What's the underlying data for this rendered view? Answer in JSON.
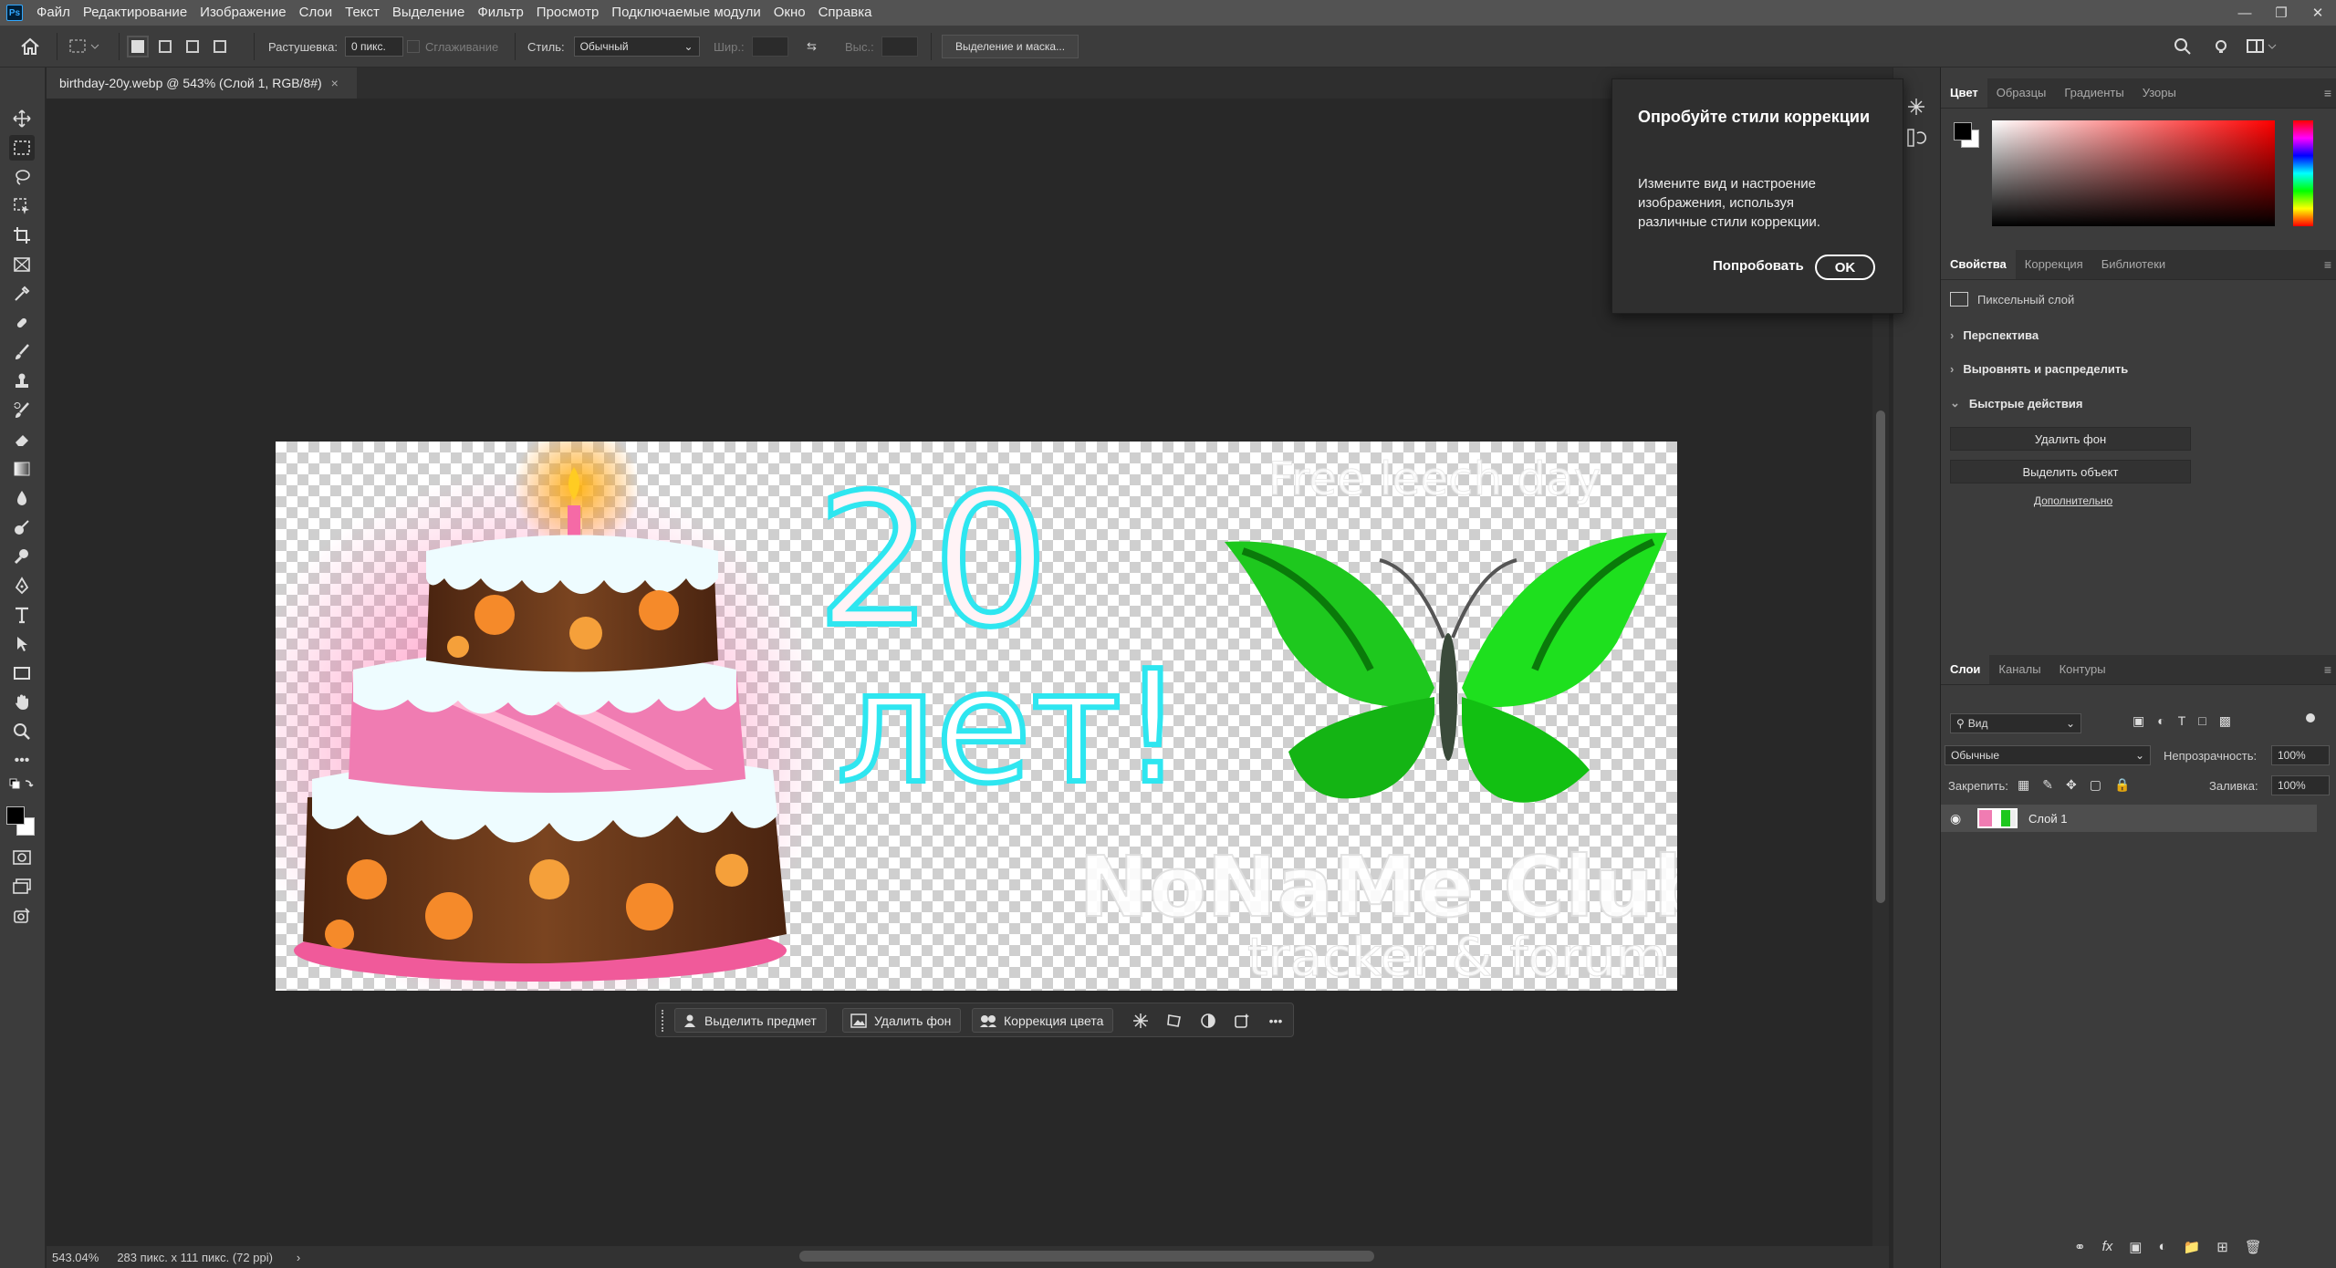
{
  "menubar": {
    "items": [
      "Файл",
      "Редактирование",
      "Изображение",
      "Слои",
      "Текст",
      "Выделение",
      "Фильтр",
      "Просмотр",
      "Подключаемые модули",
      "Окно",
      "Справка"
    ]
  },
  "options": {
    "feather_label": "Растушевка:",
    "feather_value": "0 пикс.",
    "antialias_label": "Сглаживание",
    "style_label": "Стиль:",
    "style_value": "Обычный",
    "width_label": "Шир.:",
    "height_label": "Выс.:",
    "select_mask_button": "Выделение и маска..."
  },
  "document": {
    "tab_title": "birthday-20y.webp @ 543% (Слой 1, RGB/8#)",
    "close_glyph": "×"
  },
  "canvas_art": {
    "number": "20",
    "word": "лет!",
    "top_text": "Free leech day",
    "club": "NoNaMe Club",
    "club_sub": "tracker & forum"
  },
  "context_bar": {
    "select_subject": "Выделить предмет",
    "remove_bg": "Удалить фон",
    "color_correction": "Коррекция цвета",
    "more": "•••"
  },
  "popup": {
    "title": "Опробуйте стили коррекции",
    "body": "Измените вид и настроение изображения, используя различные стили коррекции.",
    "try_label": "Попробовать",
    "ok_label": "OK"
  },
  "status": {
    "zoom": "543.04%",
    "doc_info": "283 пикс. x 111 пикс. (72 ppi)",
    "arrow": "›"
  },
  "color_panel": {
    "tabs": [
      "Цвет",
      "Образцы",
      "Градиенты",
      "Узоры"
    ],
    "foreground": "#000000",
    "background": "#ffffff"
  },
  "properties_panel": {
    "tabs": [
      "Свойства",
      "Коррекция",
      "Библиотеки"
    ],
    "layer_kind": "Пиксельный слой",
    "sections": [
      "Перспектива",
      "Выровнять и распределить",
      "Быстрые действия"
    ],
    "quick_actions": [
      "Удалить фон",
      "Выделить объект"
    ],
    "more_link": "Дополнительно"
  },
  "layers_panel": {
    "tabs": [
      "Слои",
      "Каналы",
      "Контуры"
    ],
    "filter_label": "Вид",
    "blend_mode": "Обычные",
    "opacity_label": "Непрозрачность:",
    "opacity_value": "100%",
    "lock_label": "Закрепить:",
    "fill_label": "Заливка:",
    "fill_value": "100%",
    "layers": [
      {
        "name": "Слой 1"
      }
    ]
  },
  "colors": {
    "accent": "#31a8ff",
    "butterfly": "#14d614",
    "number_outline": "#2ee6f0",
    "cake_icing_pink": "#ee6ea4",
    "cake_chocolate": "#6b3a1c"
  }
}
